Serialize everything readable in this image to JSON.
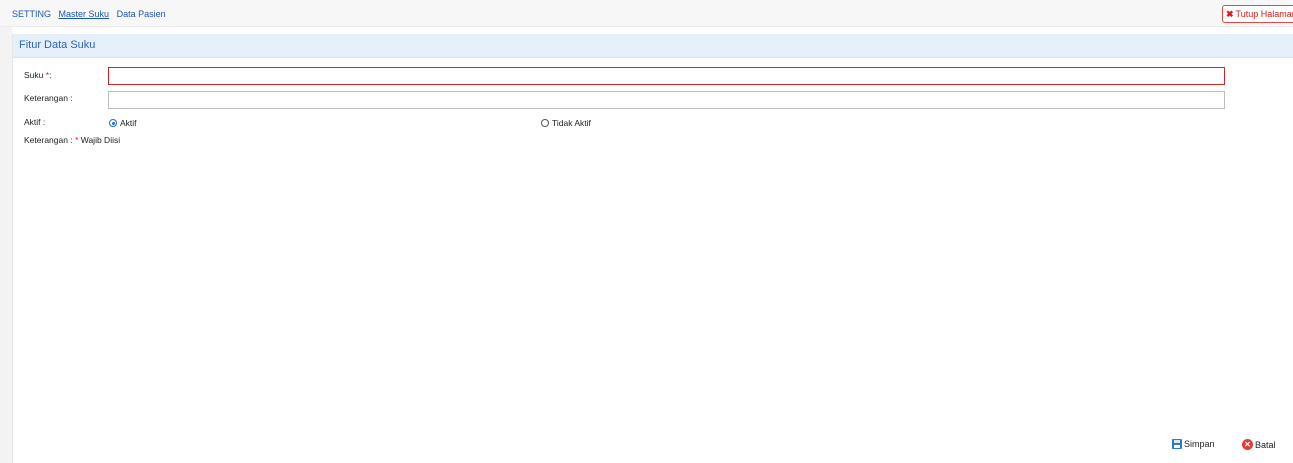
{
  "breadcrumb": {
    "root": "SETTING",
    "current": "Master Suku",
    "next": "Data Pasien"
  },
  "close_page": {
    "icon": "x-icon",
    "label": "Tutup Halaman"
  },
  "panel": {
    "title": "Fitur Data Suku"
  },
  "form": {
    "suku_label": "Suku",
    "suku_required_mark": "*",
    "suku_colon": ":",
    "suku_value": "",
    "keterangan_label": "Keterangan :",
    "keterangan_value": "",
    "aktif_label": "Aktif :",
    "radio_aktif": "Aktif",
    "radio_tidak_aktif": "Tidak Aktif",
    "selected": "Aktif"
  },
  "note": {
    "prefix": "Keterangan :",
    "mark": "*",
    "text": "Wajib Diisi"
  },
  "buttons": {
    "save": "Simpan",
    "cancel": "Batal"
  },
  "colors": {
    "link": "#1b55b5",
    "header_bg": "#e6f0fb",
    "header_text": "#2a63b8",
    "required": "#e01b1b",
    "invalid_border": "#c62828"
  }
}
